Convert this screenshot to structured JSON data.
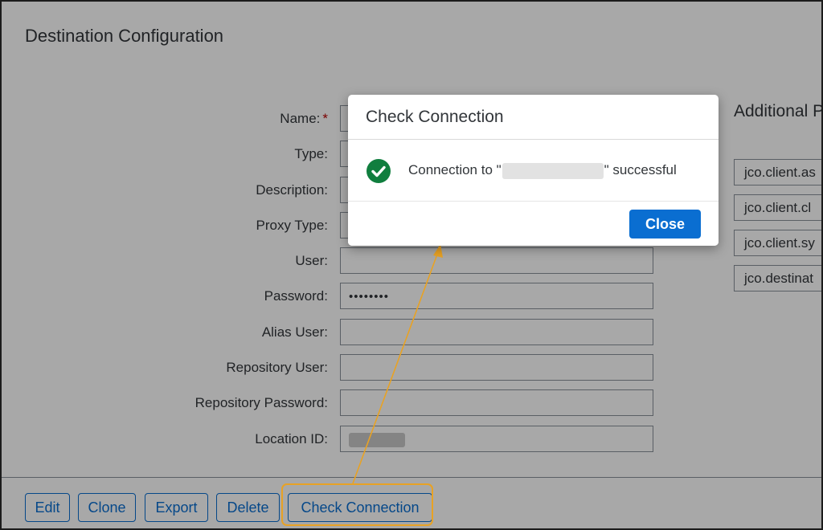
{
  "page": {
    "title": "Destination Configuration"
  },
  "form": {
    "name_label": "Name:",
    "required_mark": "*",
    "type_label": "Type:",
    "description_label": "Description:",
    "proxy_type_label": "Proxy Type:",
    "user_label": "User:",
    "password_label": "Password:",
    "password_value": "••••••••",
    "alias_user_label": "Alias User:",
    "repository_user_label": "Repository User:",
    "repository_password_label": "Repository Password:",
    "location_id_label": "Location ID:"
  },
  "additional_properties": {
    "title": "Additional P",
    "items": [
      "jco.client.as",
      "jco.client.cl",
      "jco.client.sy",
      "jco.destinat"
    ]
  },
  "toolbar": {
    "edit": "Edit",
    "clone": "Clone",
    "export": "Export",
    "delete": "Delete",
    "check_connection": "Check Connection"
  },
  "dialog": {
    "title": "Check Connection",
    "message_prefix": "Connection to \"",
    "message_suffix": "\" successful",
    "close": "Close",
    "icon": "success-check-icon"
  },
  "colors": {
    "accent": "#0a6ed1",
    "success": "#107e3e",
    "highlight": "#e8a224",
    "required": "#bb0000"
  }
}
